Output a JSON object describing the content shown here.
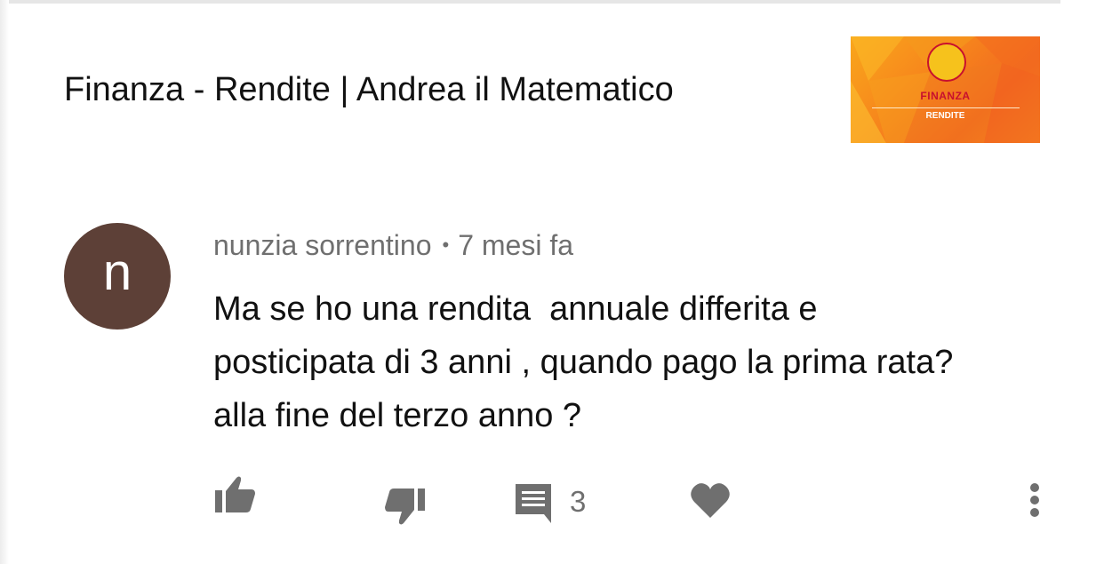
{
  "video": {
    "title": "Finanza - Rendite | Andrea il Matematico",
    "thumbnail": {
      "title": "FINANZA",
      "subtitle": "RENDITE"
    }
  },
  "comment": {
    "avatar_letter": "n",
    "author": "nunzia sorrentino",
    "separator": "•",
    "time": "7 mesi fa",
    "text_lines": [
      "Ma se ho una rendita  annuale differita e",
      "posticipata di 3 anni , quando pago la prima rata?",
      "alla fine del terzo anno ?"
    ],
    "reply_count": "3"
  },
  "colors": {
    "avatar_bg": "#5d4037",
    "icon": "#6f6f6f",
    "thumbnail_orange": "#f7891c",
    "thumbnail_red": "#c8102e"
  },
  "icons": {
    "like": "thumb-up-icon",
    "dislike": "thumb-down-icon",
    "reply": "comment-icon",
    "heart": "heart-icon",
    "menu": "more-vert-icon"
  }
}
